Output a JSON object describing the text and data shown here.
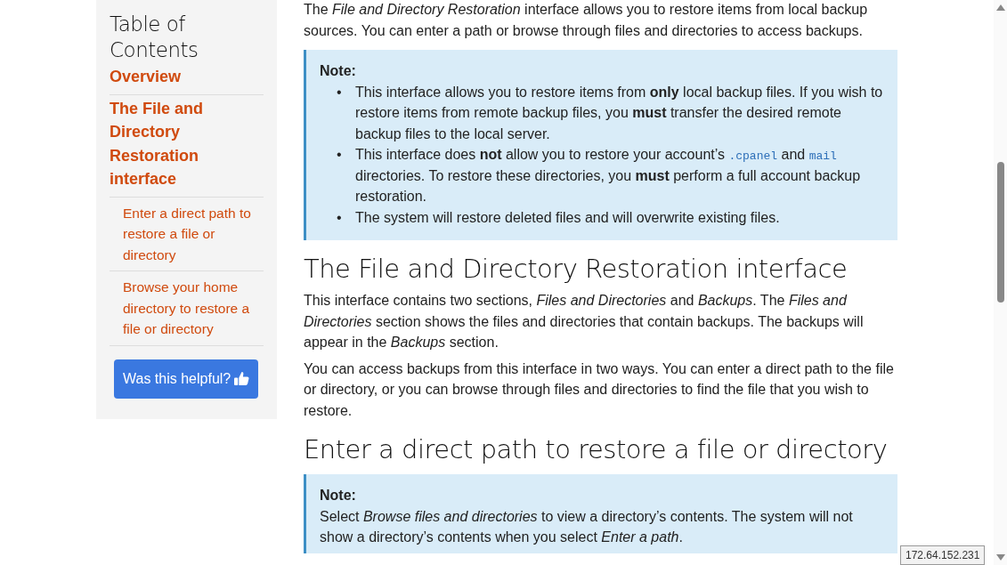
{
  "sidebar": {
    "title": "Table of Contents",
    "items": [
      {
        "label": "Overview"
      },
      {
        "label": "The File and Directory Restoration interface",
        "children": [
          {
            "label": "Enter a direct path to restore a file or directory"
          },
          {
            "label": "Browse your home directory to restore a file or directory"
          }
        ]
      }
    ],
    "feedback_button": "Was this helpful?"
  },
  "content": [
    {
      "kind": "paragraph",
      "text": "The *File and Directory Restoration* interface allows you to restore items from local backup sources. You can enter a path or browse through files and directories to access backups."
    },
    {
      "kind": "note",
      "title": "Note:",
      "bullets": [
        {
          "marker": "•",
          "segments": [
            {
              "kind": "text",
              "text": "This interface allows you to restore items from **only** local backup files. If you wish to restore items from remote backup files, you **must** transfer the desired remote backup files to the local server."
            }
          ]
        },
        {
          "marker": "•",
          "segments": [
            {
              "kind": "text",
              "text": "This interface does **not** allow you to restore your account’s "
            },
            {
              "kind": "code",
              "text": ".cpanel"
            },
            {
              "kind": "text",
              "text": " and "
            },
            {
              "kind": "code",
              "text": "mail"
            },
            {
              "kind": "text",
              "text": " directories. To restore these directories, you **must** perform a full account backup restoration."
            }
          ]
        },
        {
          "marker": "•",
          "segments": [
            {
              "kind": "text",
              "text": "The system will restore deleted files and will overwrite existing files."
            }
          ]
        }
      ]
    },
    {
      "kind": "heading",
      "text": "The File and Directory Restoration interface"
    },
    {
      "kind": "paragraph",
      "text": "This interface contains two sections, *Files and Directories* and *Backups*. The *Files and Directories* section shows the files and directories that contain backups. The backups will appear in the *Backups* section."
    },
    {
      "kind": "paragraph",
      "text": "You can access backups from this interface in two ways. You can enter a direct path to the file or directory, or you can browse through files and directories to find the file that you wish to restore."
    },
    {
      "kind": "heading",
      "text": "Enter a direct path to restore a file or directory"
    },
    {
      "kind": "note",
      "title": "Note:",
      "text": "Select *Browse files and directories* to view a directory’s contents. The system will not show a directory’s contents when you select *Enter a path*."
    }
  ],
  "status_tooltip": "172.64.152.231"
}
